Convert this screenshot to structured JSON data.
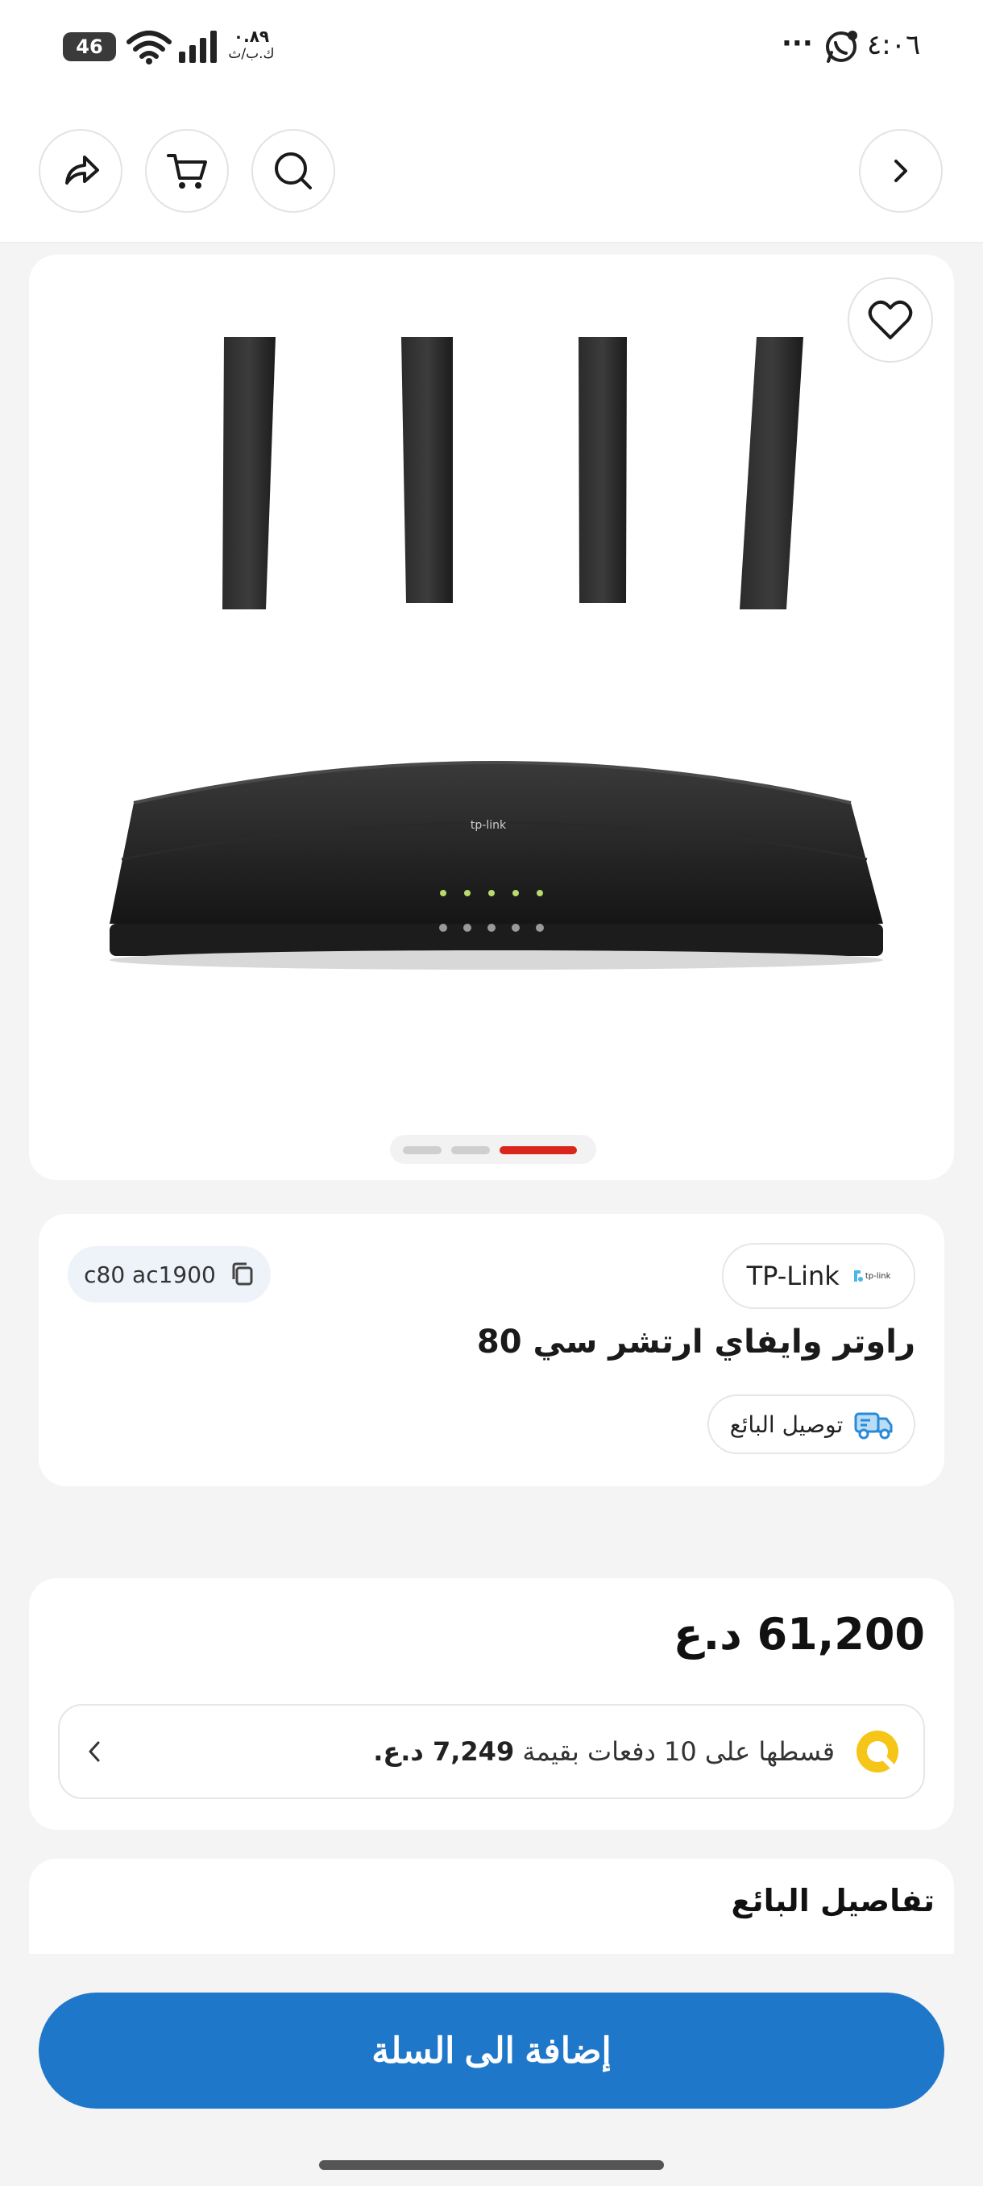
{
  "status_bar": {
    "time": "٤:٠٦",
    "battery": "46",
    "network_speed": "٠.٨٩",
    "network_unit": "ك.ب/ث",
    "more": "···"
  },
  "topbar": {
    "icons": [
      "chevron-right-icon",
      "search-icon",
      "cart-icon",
      "share-icon"
    ]
  },
  "gallery": {
    "pages": 3,
    "active_page": 3,
    "accent": "#d9261c"
  },
  "product": {
    "brand": "TP-Link",
    "brand_logo_text": "tp-link",
    "sku": "c80 ac1900",
    "title": "راوتر وايفاي ارتشر سي 80",
    "delivery_label": "توصيل البائع"
  },
  "price": {
    "amount": "61,200 د.ع",
    "installment_prefix": "قسطها على 10 دفعات بقيمة ",
    "installment_amount": "7,249 د.ع."
  },
  "seller": {
    "heading": "تفاصيل البائع"
  },
  "cta": {
    "add_to_cart": "إضافة الى السلة",
    "color": "#1f77c9"
  }
}
